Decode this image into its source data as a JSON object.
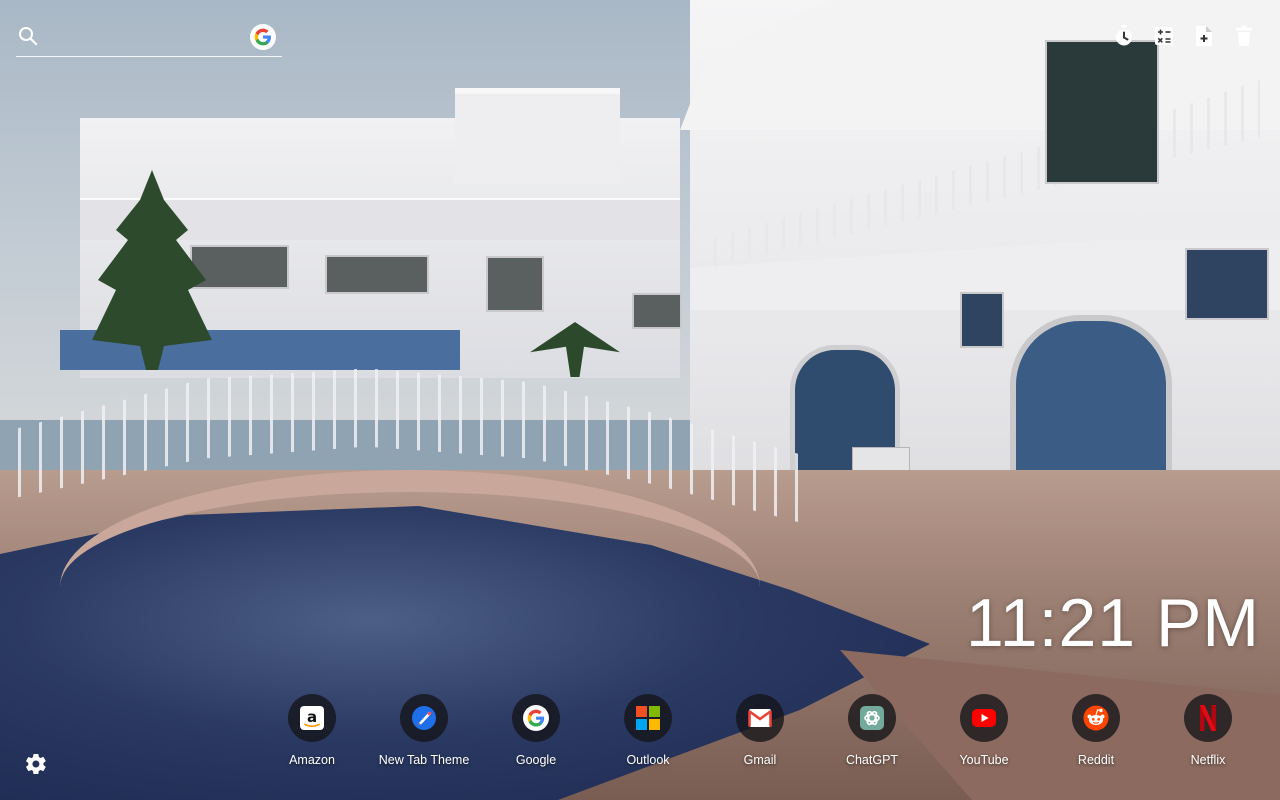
{
  "search": {
    "placeholder": "",
    "value": ""
  },
  "clock": {
    "time": "11:21 PM"
  },
  "toolbar": {
    "icons": [
      "timer-icon",
      "calculator-icon",
      "note-add-icon",
      "trash-icon"
    ]
  },
  "shortcuts": [
    {
      "label": "Amazon",
      "icon": "amazon-icon"
    },
    {
      "label": "New Tab Theme",
      "icon": "new-tab-theme-icon"
    },
    {
      "label": "Google",
      "icon": "google-icon"
    },
    {
      "label": "Outlook",
      "icon": "outlook-icon"
    },
    {
      "label": "Gmail",
      "icon": "gmail-icon"
    },
    {
      "label": "ChatGPT",
      "icon": "chatgpt-icon"
    },
    {
      "label": "YouTube",
      "icon": "youtube-icon"
    },
    {
      "label": "Reddit",
      "icon": "reddit-icon"
    },
    {
      "label": "Netflix",
      "icon": "netflix-icon"
    }
  ],
  "colors": {
    "shortcut_bg": "#141418",
    "youtube_red": "#ff0000",
    "reddit_orange": "#ff4500",
    "netflix_red": "#e50914",
    "gmail_red": "#ea4335"
  }
}
